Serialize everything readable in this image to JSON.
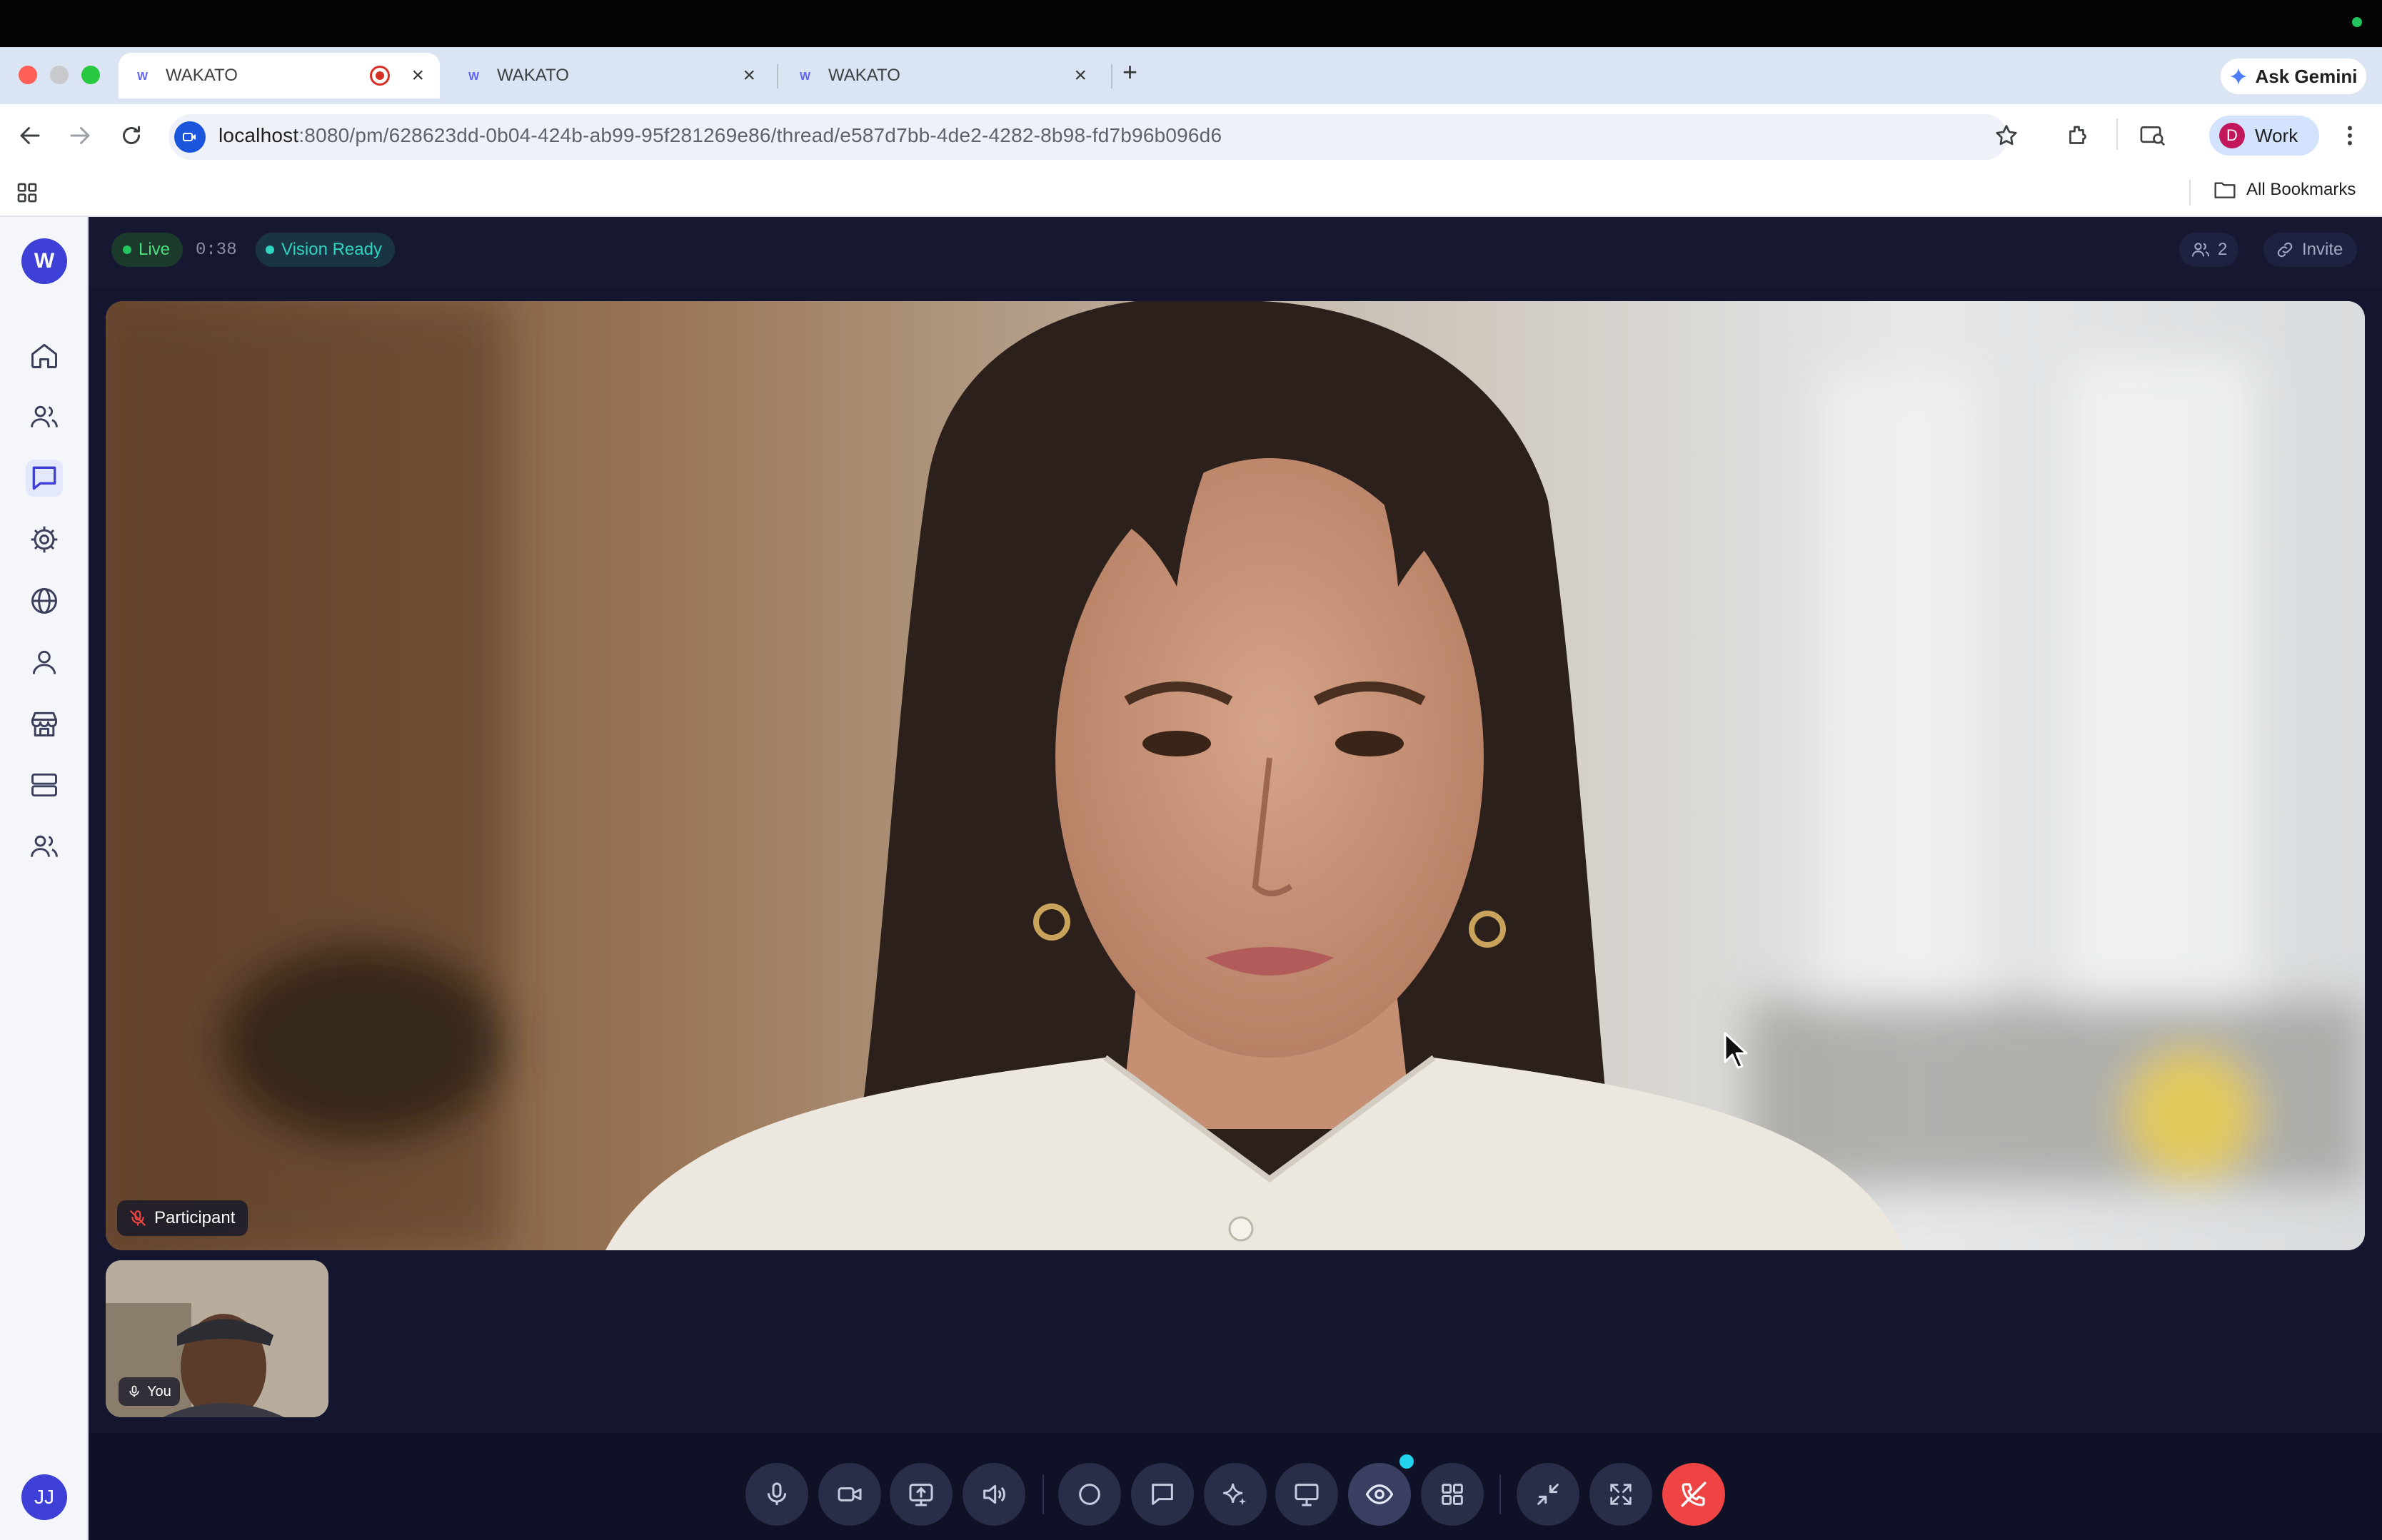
{
  "window": {
    "tabs": [
      {
        "title": "WAKATO",
        "recording": true,
        "active": true
      },
      {
        "title": "WAKATO",
        "recording": false,
        "active": false
      },
      {
        "title": "WAKATO",
        "recording": false,
        "active": false
      }
    ],
    "new_tab_label": "+",
    "ask_gemini_label": "Ask Gemini"
  },
  "toolbar": {
    "url_host": "localhost",
    "url_rest": ":8080/pm/628623dd-0b04-424b-ab99-95f281269e86/thread/e587d7bb-4de2-4282-8b98-fd7b96b096d6",
    "profile_initial": "D",
    "profile_label": "Work"
  },
  "bookmarks": {
    "all_bookmarks_label": "All Bookmarks"
  },
  "sidebar": {
    "workspace_initial": "W",
    "user_initials": "JJ",
    "items": [
      {
        "icon": "home-icon",
        "active": false
      },
      {
        "icon": "people-icon",
        "active": false
      },
      {
        "icon": "chat-icon",
        "active": true
      },
      {
        "icon": "settings-icon",
        "active": false
      },
      {
        "icon": "globe-icon",
        "active": false
      },
      {
        "icon": "person-icon",
        "active": false
      },
      {
        "icon": "store-icon",
        "active": false
      },
      {
        "icon": "server-icon",
        "active": false
      },
      {
        "icon": "team-icon",
        "active": false
      }
    ]
  },
  "call": {
    "live_label": "Live",
    "timer": "0:38",
    "vision_label": "Vision Ready",
    "participants_count": "2",
    "invite_label": "Invite",
    "main_participant_label": "Participant",
    "self_label": "You"
  },
  "colors": {
    "accent": "#3d3fd6",
    "live_green": "#22c55e",
    "vision_teal": "#2dd4bf",
    "end_call_red": "#ef4444",
    "app_bg": "#141630"
  },
  "controls": [
    {
      "icon": "microphone-icon"
    },
    {
      "icon": "video-camera-icon"
    },
    {
      "icon": "screen-share-icon"
    },
    {
      "icon": "speaker-icon"
    },
    {
      "icon": "record-circle-icon"
    },
    {
      "icon": "chat-bubble-icon"
    },
    {
      "icon": "ai-sparkle-icon"
    },
    {
      "icon": "presentation-icon"
    },
    {
      "icon": "vision-eye-icon",
      "active": true
    },
    {
      "icon": "grid-layout-icon"
    },
    {
      "icon": "minimize-icon"
    },
    {
      "icon": "fullscreen-icon"
    },
    {
      "icon": "end-call-icon"
    }
  ]
}
